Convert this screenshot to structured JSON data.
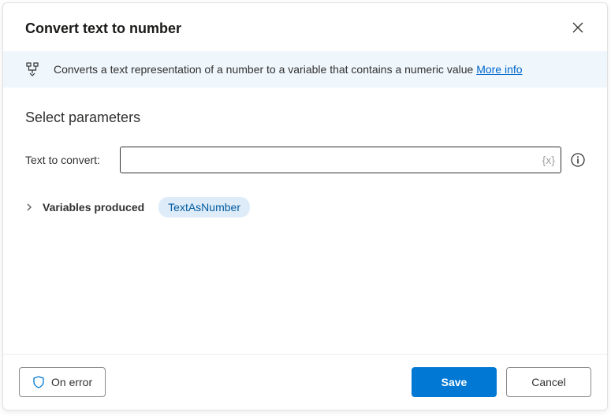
{
  "header": {
    "title": "Convert text to number"
  },
  "info": {
    "text": "Converts a text representation of a number to a variable that contains a numeric value ",
    "more": "More info"
  },
  "params": {
    "section_title": "Select parameters",
    "text_to_convert_label": "Text to convert:",
    "text_to_convert_value": "",
    "variables_produced_label": "Variables produced",
    "variable_chip": "TextAsNumber"
  },
  "footer": {
    "on_error": "On error",
    "save": "Save",
    "cancel": "Cancel"
  }
}
